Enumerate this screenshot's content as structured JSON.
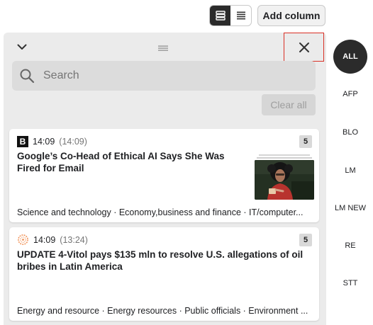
{
  "toolbar": {
    "add_column_label": "Add column"
  },
  "column": {
    "search": {
      "placeholder": "Search",
      "value": ""
    },
    "clear_all_label": "Clear all",
    "cards": [
      {
        "source_logo": "B",
        "time": "14:09",
        "time_original": "(14:09)",
        "count": "5",
        "headline": "Google’s Co-Head of Ethical AI Says She Was Fired for Email",
        "tags": "Science and technology · Economy,business and finance · IT/computer..."
      },
      {
        "source_logo": "ring-logo",
        "time": "14:09",
        "time_original": "(13:24)",
        "count": "5",
        "headline": "UPDATE 4-Vitol pays $135 mln to resolve U.S. allegations of oil bribes in Latin America",
        "tags": "Energy and resource · Energy resources · Public officials · Environment ..."
      }
    ]
  },
  "rail": {
    "items": [
      "ALL",
      "AFP",
      "BLO",
      "LM",
      "LM NEW",
      "RE",
      "STT"
    ],
    "selected": "ALL"
  },
  "colors": {
    "highlight_border": "#d93025",
    "selected_bg": "#2b2b2b"
  },
  "icons": [
    "list-view-icon",
    "compact-view-icon",
    "chevron-down-icon",
    "drag-handle-icon",
    "close-icon",
    "search-icon"
  ]
}
